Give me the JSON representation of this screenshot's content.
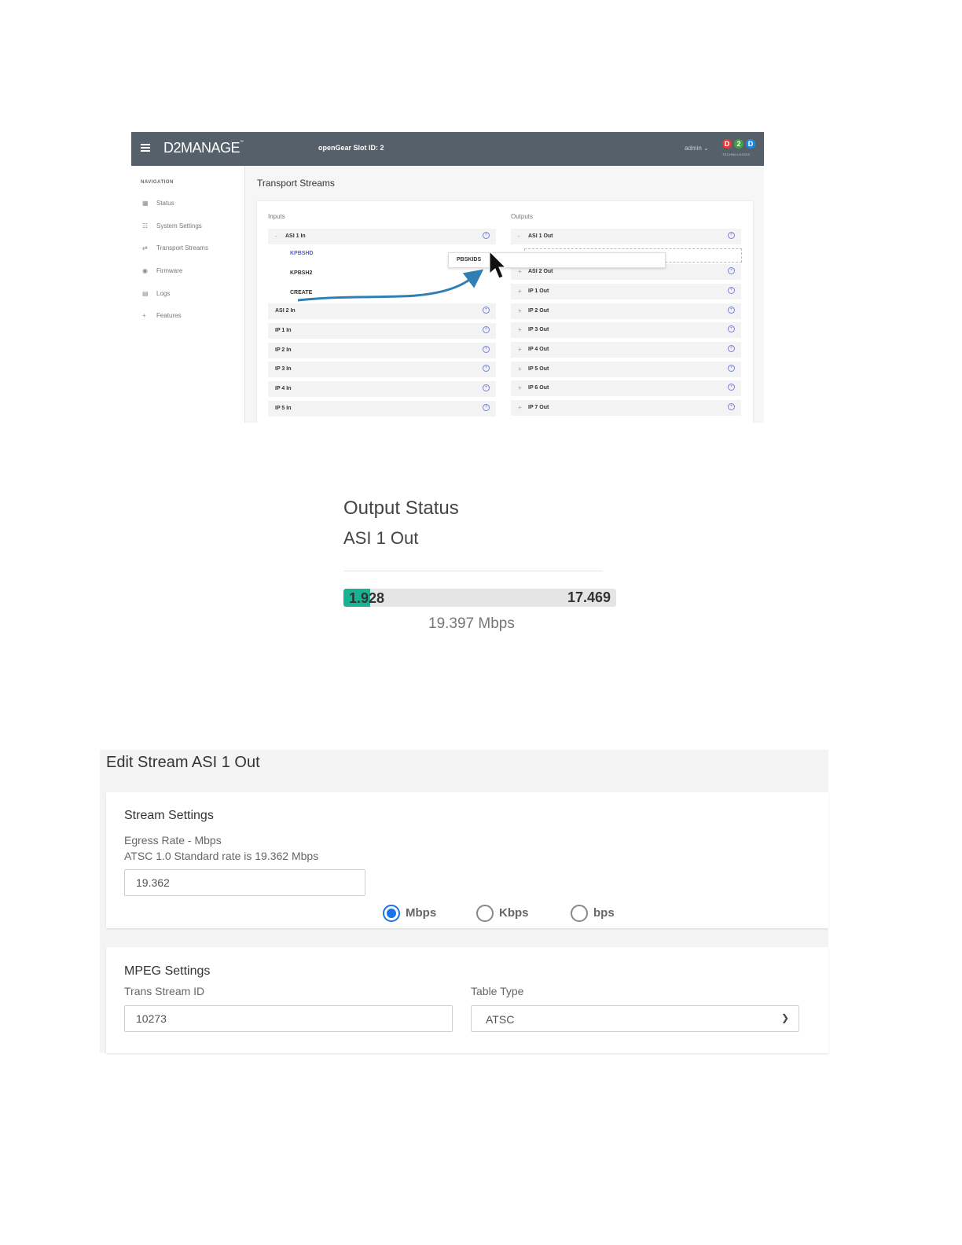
{
  "app": {
    "brand": "D2MANAGE",
    "brand_mark": "™",
    "slot": "openGear Slot ID: 2",
    "user": "admin",
    "logo": {
      "letters": [
        "D",
        "2",
        "D"
      ],
      "tagline": "TECHNOLOGIES",
      "colors": [
        "#e53935",
        "#43a047",
        "#1e88e5"
      ]
    },
    "nav_title": "NAVIGATION",
    "nav": [
      {
        "icon": "bar-chart-icon",
        "label": "Status"
      },
      {
        "icon": "sitemap-icon",
        "label": "System Settings"
      },
      {
        "icon": "transport-icon",
        "label": "Transport Streams"
      },
      {
        "icon": "chip-icon",
        "label": "Firmware"
      },
      {
        "icon": "document-icon",
        "label": "Logs"
      },
      {
        "icon": "plus-icon",
        "label": "Features"
      }
    ],
    "page_title": "Transport Streams",
    "inputs_label": "Inputs",
    "outputs_label": "Outputs",
    "inputs": [
      {
        "exp": "-",
        "label": "ASI 1 In"
      },
      {
        "exp": "",
        "label": "ASI 2 In"
      },
      {
        "exp": "",
        "label": "IP 1 In"
      },
      {
        "exp": "",
        "label": "IP 2 In"
      },
      {
        "exp": "",
        "label": "IP 3 In"
      },
      {
        "exp": "",
        "label": "IP 4 In"
      },
      {
        "exp": "",
        "label": "IP 5 In"
      }
    ],
    "input_children": [
      {
        "label": "KPBSHD",
        "color": "#5b5bd6"
      },
      {
        "label": "KPBSH2",
        "color": "#333333"
      },
      {
        "label": "CREATE",
        "color": "#333333"
      }
    ],
    "drag_item": "PBSKIDS",
    "outputs": [
      {
        "exp": "-",
        "label": "ASI 1 Out"
      },
      {
        "exp": "+",
        "label": "ASI 2 Out"
      },
      {
        "exp": "+",
        "label": "IP 1 Out"
      },
      {
        "exp": "+",
        "label": "IP 2 Out"
      },
      {
        "exp": "+",
        "label": "IP 3 Out"
      },
      {
        "exp": "+",
        "label": "IP 4 Out"
      },
      {
        "exp": "+",
        "label": "IP 5 Out"
      },
      {
        "exp": "+",
        "label": "IP 6 Out"
      },
      {
        "exp": "+",
        "label": "IP 7 Out"
      }
    ],
    "add_glyph": "+",
    "accent": "#2f7fb5"
  },
  "status": {
    "title": "Output Status",
    "stream": "ASI 1 Out",
    "used": "1.928",
    "free": "17.469",
    "total": "19.397 Mbps",
    "used_fraction": 0.0994
  },
  "edit": {
    "title": "Edit Stream ASI 1 Out",
    "stream_settings": "Stream Settings",
    "egress_label": "Egress Rate - Mbps",
    "egress_note": "ATSC 1.0 Standard rate is 19.362 Mbps",
    "egress_value": "19.362",
    "units": [
      {
        "label": "Mbps",
        "selected": true
      },
      {
        "label": "Kbps",
        "selected": false
      },
      {
        "label": "bps",
        "selected": false
      }
    ],
    "mpeg_settings": "MPEG Settings",
    "tsid_label": "Trans Stream ID",
    "tsid_value": "10273",
    "table_type_label": "Table Type",
    "table_type_value": "ATSC"
  }
}
